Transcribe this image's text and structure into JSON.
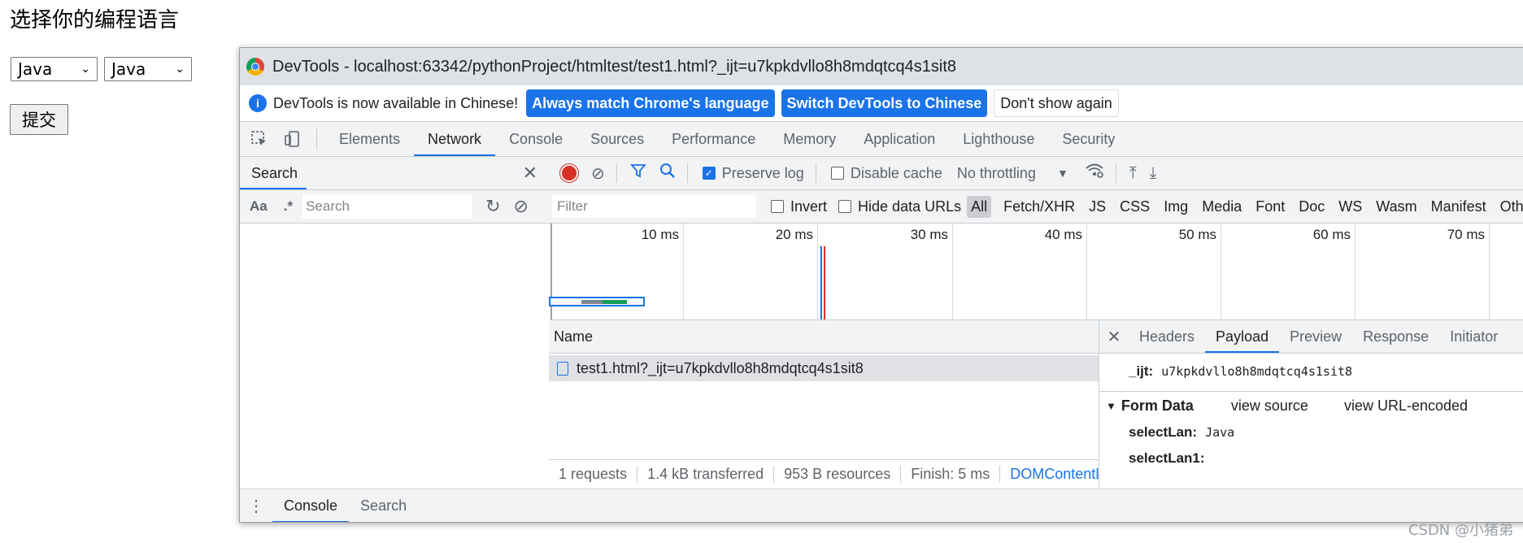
{
  "page": {
    "heading": "选择你的编程语言",
    "select1_value": "Java",
    "select2_value": "Java",
    "submit_label": "提交"
  },
  "devtools": {
    "title": "DevTools - localhost:63342/pythonProject/htmltest/test1.html?_ijt=u7kpkdvllo8h8mdqtcq4s1sit8",
    "infobar": {
      "message": "DevTools is now available in Chinese!",
      "btn_match": "Always match Chrome's language",
      "btn_switch": "Switch DevTools to Chinese",
      "btn_dismiss": "Don't show again"
    },
    "tabs": [
      {
        "label": "Elements"
      },
      {
        "label": "Network"
      },
      {
        "label": "Console"
      },
      {
        "label": "Sources"
      },
      {
        "label": "Performance"
      },
      {
        "label": "Memory"
      },
      {
        "label": "Application"
      },
      {
        "label": "Lighthouse"
      },
      {
        "label": "Security"
      }
    ],
    "active_tab": "Network",
    "search_pane": {
      "tab_label": "Search",
      "case_toggle": "Aa",
      "regex_toggle": ".*",
      "input_placeholder": "Search"
    },
    "network_toolbar": {
      "preserve_log": "Preserve log",
      "preserve_log_checked": true,
      "disable_cache": "Disable cache",
      "disable_cache_checked": false,
      "throttling": "No throttling"
    },
    "filter_row": {
      "filter_placeholder": "Filter",
      "invert": "Invert",
      "hide_data_urls": "Hide data URLs",
      "types": [
        "All",
        "Fetch/XHR",
        "JS",
        "CSS",
        "Img",
        "Media",
        "Font",
        "Doc",
        "WS",
        "Wasm",
        "Manifest",
        "Other"
      ],
      "active_type": "All"
    },
    "timeline": {
      "ticks": [
        "10 ms",
        "20 ms",
        "30 ms",
        "40 ms",
        "50 ms",
        "60 ms",
        "70 ms"
      ]
    },
    "requests": {
      "header": "Name",
      "rows": [
        {
          "name": "test1.html?_ijt=u7kpkdvllo8h8mdqtcq4s1sit8"
        }
      ]
    },
    "status": {
      "requests": "1 requests",
      "transferred": "1.4 kB transferred",
      "resources": "953 B resources",
      "finish": "Finish: 5 ms",
      "dcl": "DOMContentL"
    },
    "detail": {
      "tabs": [
        "Headers",
        "Payload",
        "Preview",
        "Response",
        "Initiator"
      ],
      "active_tab": "Payload",
      "query_key": "_ijt:",
      "query_value": "u7kpkdvllo8h8mdqtcq4s1sit8",
      "form_data_title": "Form Data",
      "view_source": "view source",
      "view_url_encoded": "view URL-encoded",
      "form_fields": [
        {
          "key": "selectLan:",
          "value": "Java"
        },
        {
          "key": "selectLan1:",
          "value": ""
        }
      ]
    },
    "drawer": {
      "tabs": [
        "Console",
        "Search"
      ],
      "active_tab": "Console"
    }
  },
  "watermark": "CSDN @小猪弟",
  "colors": {
    "accent": "#1a73e8",
    "record": "#d93025",
    "panel_bg": "#f1f3f4",
    "titlebar_bg": "#dee1e6"
  }
}
